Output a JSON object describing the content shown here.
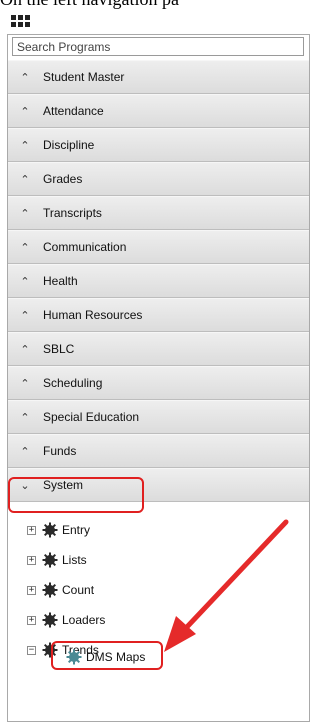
{
  "caption": "On the left navigation pa",
  "search": {
    "placeholder": "Search Programs"
  },
  "menu": [
    {
      "label": "Student Master"
    },
    {
      "label": "Attendance"
    },
    {
      "label": "Discipline"
    },
    {
      "label": "Grades"
    },
    {
      "label": "Transcripts"
    },
    {
      "label": "Communication"
    },
    {
      "label": "Health"
    },
    {
      "label": "Human Resources"
    },
    {
      "label": "SBLC"
    },
    {
      "label": "Scheduling"
    },
    {
      "label": "Special Education"
    },
    {
      "label": "Funds"
    }
  ],
  "system": {
    "label": "System"
  },
  "tree": {
    "entry": "Entry",
    "lists": "Lists",
    "count": "Count",
    "loaders": "Loaders",
    "trends": "Trends",
    "dms_maps": "DMS Maps"
  },
  "icons": {
    "collapsed_chevron": "chevron-up-icon",
    "expanded_chevron": "chevron-down-icon",
    "expand": "plus-box-icon",
    "collapse": "minus-box-icon",
    "folder": "gear-icon"
  },
  "colors": {
    "highlight": "#e02020",
    "menu_bg": "#e4e4e4",
    "border": "#a9a9a9"
  }
}
